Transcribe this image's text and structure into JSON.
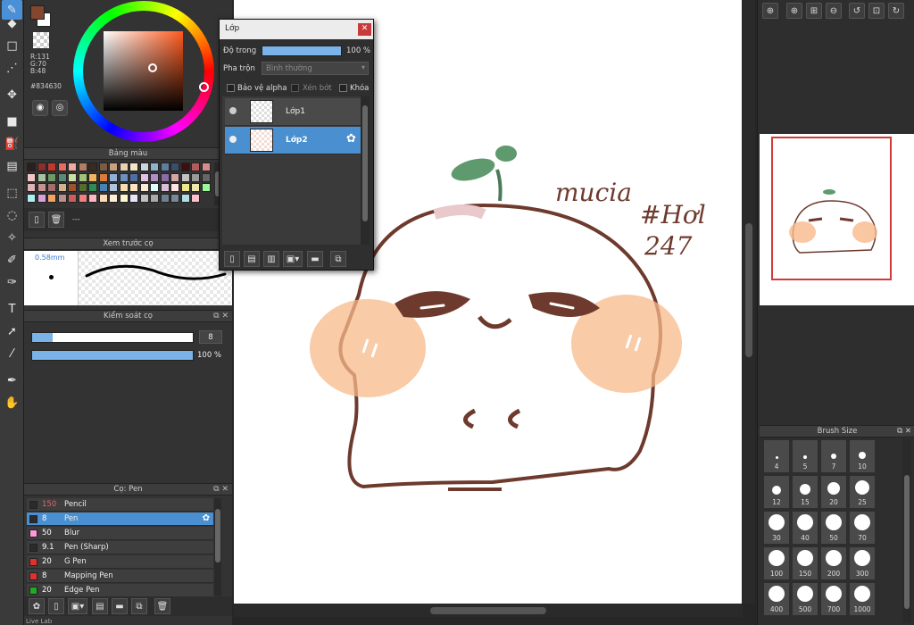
{
  "colors": {
    "current": "#834630",
    "r_label": "R:131",
    "g_label": "G:70",
    "b_label": "B:48",
    "hex_label": "#834630"
  },
  "palette_panel": {
    "title": "Bảng màu",
    "footer": "---",
    "swatches": [
      "#2a1f1f",
      "#8b2e2e",
      "#c0392b",
      "#e86b5f",
      "#f1a9a0",
      "#b47b65",
      "#3a2a20",
      "#7a5c45",
      "#c7a27c",
      "#e8d2b0",
      "#f5e6c8",
      "#c9d6df",
      "#8fb3c9",
      "#5c7e9f",
      "#3b4f6b",
      "#3a1010",
      "#b55a5a",
      "#d98c8c",
      "#f3c7c7",
      "#a7c4a0",
      "#6e9a66",
      "#5a8a78",
      "#cce0a3",
      "#9fc37a",
      "#f0b45f",
      "#d97b3b",
      "#8fb0d9",
      "#6d8fc2",
      "#4f6fa3",
      "#e2c2e6",
      "#b08cc9",
      "#8b6aa8",
      "#d6a6a6",
      "#c4c4c4",
      "#999999",
      "#666666",
      "#deb3b3",
      "#c79292",
      "#a36e6e",
      "#d2b48c",
      "#a0522d",
      "#556b2f",
      "#2e8b57",
      "#4682b4",
      "#b0c4de",
      "#f5deb3",
      "#ffe4c4",
      "#faebd7",
      "#e0ffff",
      "#d8bfd8",
      "#ffe4e1",
      "#f0e68c",
      "#eee8aa",
      "#98fb98",
      "#afeeee",
      "#dda0dd",
      "#f4a460",
      "#bc8f8f",
      "#cd5c5c",
      "#f08080",
      "#ffb6c1",
      "#ffdab9",
      "#ffefd5",
      "#fffacd",
      "#e6e6fa",
      "#c0c0c0",
      "#a9a9a9",
      "#708090",
      "#778899",
      "#b0e0e6",
      "#ffc0cb"
    ]
  },
  "brush_preview": {
    "title": "Xem trước cọ",
    "size_label": "0.58mm"
  },
  "brush_control": {
    "title": "Kiểm soát cọ",
    "size_value": "8",
    "size_fill": 0.13,
    "opacity_value": "100 %",
    "opacity_fill": 1.0
  },
  "brush_list": {
    "title": "Cọ: Pen",
    "items": [
      {
        "size": "150",
        "name": "Pencil",
        "color": "#2b2b2b",
        "size_color": "#e06666"
      },
      {
        "size": "8",
        "name": "Pen",
        "color": "#2b2b2b",
        "size_color": "#ffffff"
      },
      {
        "size": "50",
        "name": "Blur",
        "color": "#ff99dd",
        "size_color": "#ffffff"
      },
      {
        "size": "9.1",
        "name": "Pen (Sharp)",
        "color": "#2b2b2b",
        "size_color": "#ffffff"
      },
      {
        "size": "20",
        "name": "G Pen",
        "color": "#e03030",
        "size_color": "#ffffff"
      },
      {
        "size": "8",
        "name": "Mapping Pen",
        "color": "#e03030",
        "size_color": "#ffffff"
      },
      {
        "size": "20",
        "name": "Edge Pen",
        "color": "#22aa22",
        "size_color": "#ffffff"
      }
    ]
  },
  "layer_window": {
    "title": "Lớp",
    "opacity_label": "Độ trong",
    "opacity_value": "100 %",
    "blend_label": "Pha trộn",
    "blend_value": "Bình thường",
    "protect_alpha": "Bảo vệ alpha",
    "clipping": "Xén bớt",
    "lock": "Khóa",
    "layers": [
      {
        "name": "Lớp1",
        "selected": false
      },
      {
        "name": "Lớp2",
        "selected": true
      }
    ]
  },
  "canvas": {
    "handwriting": [
      "mucia",
      "#Hơl",
      "247"
    ]
  },
  "brush_size_panel": {
    "title": "Brush Size",
    "sizes": [
      "4",
      "5",
      "7",
      "10",
      "12",
      "15",
      "20",
      "25",
      "30",
      "40",
      "50",
      "70",
      "100",
      "150",
      "200",
      "300",
      "400",
      "500",
      "700",
      "1000"
    ]
  },
  "status_text": "Live Lab"
}
